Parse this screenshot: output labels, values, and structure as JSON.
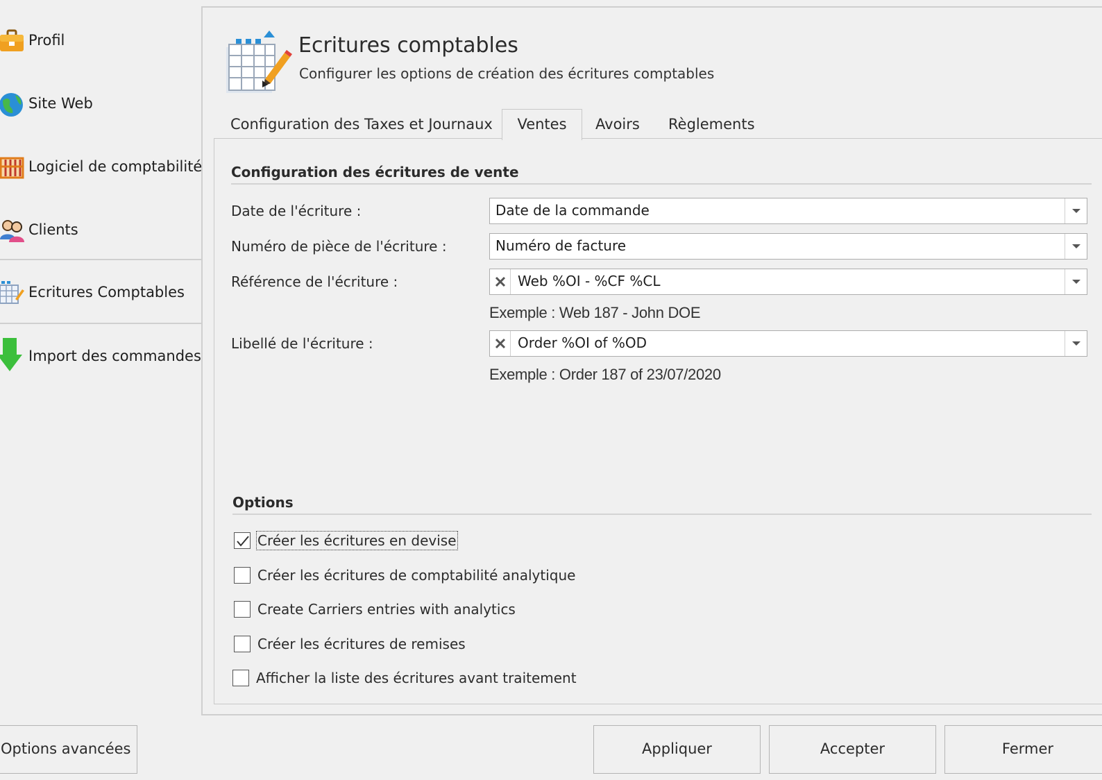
{
  "sidebar": {
    "items": [
      {
        "label": "Profil",
        "icon": "briefcase-icon"
      },
      {
        "label": "Site Web",
        "icon": "globe-icon"
      },
      {
        "label": "Logiciel de comptabilité",
        "icon": "abacus-icon"
      },
      {
        "label": "Clients",
        "icon": "users-icon"
      },
      {
        "label": "Ecritures Comptables",
        "icon": "ledger-edit-icon",
        "selected": true
      },
      {
        "label": "Import des commandes",
        "icon": "download-arrow-icon"
      }
    ]
  },
  "header": {
    "title": "Ecritures comptables",
    "subtitle": "Configurer les options de création des écritures comptables",
    "icon": "spreadsheet-edit-icon"
  },
  "tabs": [
    {
      "label": "Configuration des Taxes et Journaux",
      "active": false
    },
    {
      "label": "Ventes",
      "active": true
    },
    {
      "label": "Avoirs",
      "active": false
    },
    {
      "label": "Règlements",
      "active": false
    }
  ],
  "sales": {
    "group_title": "Configuration des écritures de vente",
    "fields": [
      {
        "label": "Date de l'écriture :",
        "value": "Date de la commande"
      },
      {
        "label": "Numéro de pièce de l'écriture :",
        "value": "Numéro de facture"
      },
      {
        "label": "Référence de l'écriture :",
        "value": "Web %OI - %CF %CL",
        "example": "Exemple : Web 187 - John DOE"
      },
      {
        "label": "Libellé de l'écriture :",
        "value": "Order %OI of %OD",
        "example": "Exemple : Order 187 of 23/07/2020"
      }
    ]
  },
  "options": {
    "group_title": "Options",
    "items": [
      {
        "label": "Créer les écritures en devise",
        "checked": true
      },
      {
        "label": "Créer les écritures de comptabilité analytique",
        "checked": false
      },
      {
        "label": "Create Carriers entries with analytics",
        "checked": false
      },
      {
        "label": "Créer les écritures de remises",
        "checked": false
      },
      {
        "label": "Afficher la liste des écritures avant traitement",
        "checked": false
      }
    ]
  },
  "buttons": {
    "advanced": "Options avancées",
    "apply": "Appliquer",
    "accept": "Accepter",
    "close": "Fermer"
  },
  "colors": {
    "background": "#f0f0f0",
    "border": "#c9c9c9",
    "accent_blue": "#2a6ebd",
    "accent_green": "#3cbf3c"
  }
}
